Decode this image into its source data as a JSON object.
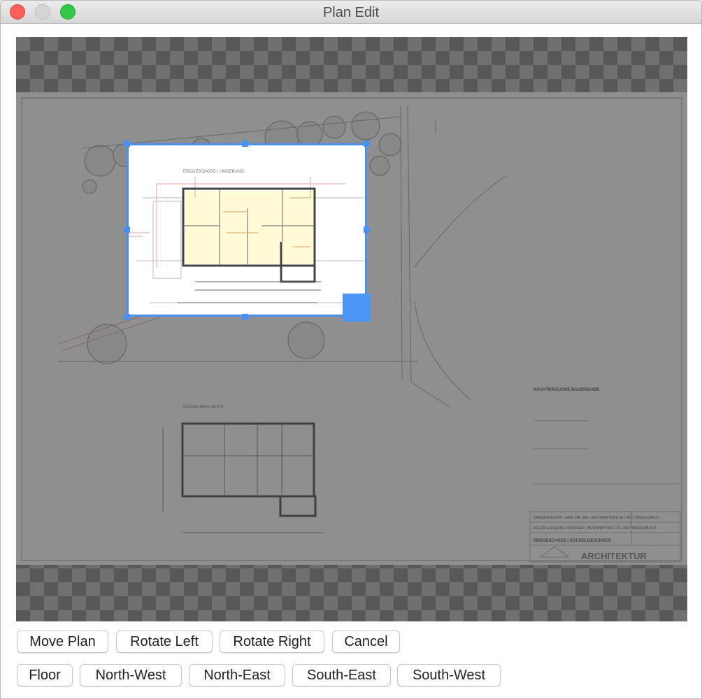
{
  "window": {
    "title": "Plan Edit"
  },
  "plan": {
    "sheet_labels": {
      "ground_floor": "ERDGESCHOSS | UMGEBUNG",
      "basement": "SOCKELGESCHOSS",
      "submission": "NACHTRÄGLICHE BAUEINGABE",
      "project": "SANIERUNG EFH | GEBI. NR. 865 | BUCHMATTWEG 15 | 4537 WIEDLISBACH",
      "client": "EGLON & EVELINE KREYAGER | BUCHMATTWEG 15 | 4537 WIEDLISBACH",
      "sheet_title": "ERDGESCHOSS | SOCKELGESCHOSS",
      "logo_text": "ARCHITEKTUR"
    }
  },
  "toolbar": {
    "move_plan": "Move Plan",
    "rotate_left": "Rotate Left",
    "rotate_right": "Rotate Right",
    "cancel": "Cancel"
  },
  "orientation": {
    "floor": "Floor",
    "north_west": "North-West",
    "north_east": "North-East",
    "south_east": "South-East",
    "south_west": "South-West"
  },
  "colors": {
    "selection": "#4a90f0",
    "close": "#fc5f57",
    "maximize": "#33c748"
  }
}
